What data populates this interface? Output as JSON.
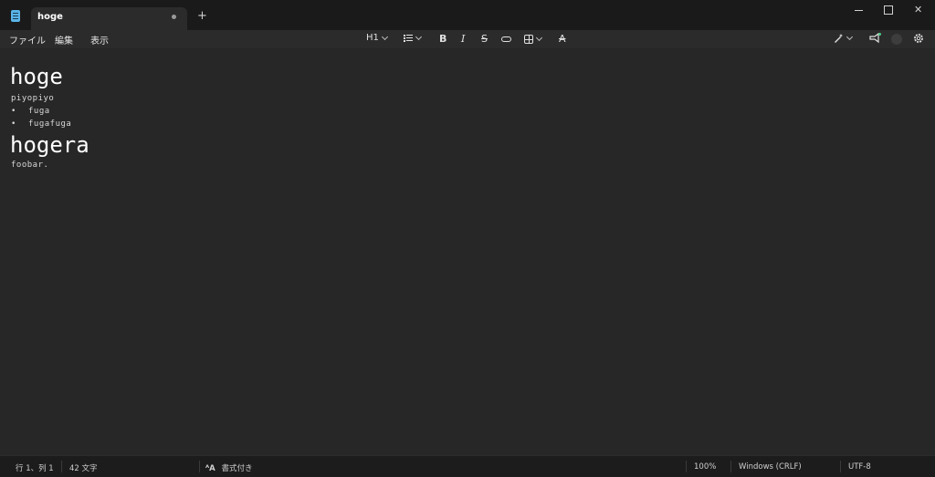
{
  "titlebar": {
    "tab_title": "hoge",
    "new_tab_label": "+",
    "close_label": "✕"
  },
  "menu": {
    "file": "ファイル",
    "edit": "編集",
    "view": "表示"
  },
  "toolbar": {
    "heading": "H1",
    "bold": "B",
    "italic": "I",
    "strike": "S",
    "clear_format": "A"
  },
  "document": {
    "heading1": "hoge",
    "paragraph1": "piyopiyo",
    "bullets": [
      "fuga",
      "fugafuga"
    ],
    "bullet_char": "•",
    "heading2": "hogera",
    "paragraph2": "foobar."
  },
  "statusbar": {
    "position": "行 1、列 1",
    "char_count": "42 文字",
    "format_icon_label": "ᴬA",
    "format_mode": "書式付き",
    "zoom": "100%",
    "line_ending": "Windows (CRLF)",
    "encoding": "UTF-8"
  },
  "colors": {
    "accent": "#5ab4e8",
    "background": "#272727",
    "notification": "#4ccf8a"
  }
}
